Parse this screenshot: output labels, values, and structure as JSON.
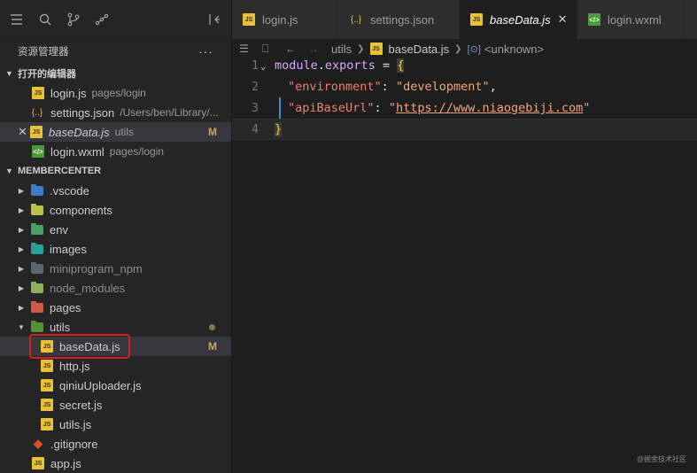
{
  "activity_bar": {
    "icons": [
      "files-icon",
      "search-icon",
      "source-control-icon",
      "graph-icon",
      "collapse-panel-icon"
    ]
  },
  "explorer": {
    "title": "资源管理器",
    "more": "···"
  },
  "open_editors": {
    "header": "打开的编辑器",
    "items": [
      {
        "name": "login.js",
        "desc": "pages/login",
        "type": "js"
      },
      {
        "name": "settings.json",
        "desc": "/Users/ben/Library/...",
        "type": "json"
      },
      {
        "name": "baseData.js",
        "desc": "utils",
        "type": "js",
        "badge": "M"
      },
      {
        "name": "login.wxml",
        "desc": "pages/login",
        "type": "wxml"
      }
    ]
  },
  "project": {
    "header": "MEMBERCENTER",
    "folders": [
      {
        "name": ".vscode"
      },
      {
        "name": "components"
      },
      {
        "name": "env"
      },
      {
        "name": "images"
      },
      {
        "name": "miniprogram_npm"
      },
      {
        "name": "node_modules"
      },
      {
        "name": "pages"
      },
      {
        "name": "utils"
      }
    ],
    "utils_files": [
      {
        "name": "baseData.js",
        "badge": "M"
      },
      {
        "name": "http.js"
      },
      {
        "name": "qiniuUploader.js"
      },
      {
        "name": "secret.js"
      },
      {
        "name": "utils.js"
      }
    ],
    "root_files": [
      {
        "name": ".gitignore"
      },
      {
        "name": "app.js"
      }
    ]
  },
  "tabs": [
    {
      "label": "login.js",
      "type": "js"
    },
    {
      "label": "settings.json",
      "type": "json"
    },
    {
      "label": "baseData.js",
      "type": "js"
    },
    {
      "label": "login.wxml",
      "type": "wxml"
    }
  ],
  "breadcrumb": {
    "folder": "utils",
    "file": "baseData.js",
    "symbol": "<unknown>"
  },
  "code": {
    "line_numbers": [
      "1",
      "2",
      "3",
      "4"
    ],
    "l1_kw": "module",
    "l1_dot": ".",
    "l1_prop": "exports",
    "l1_eq": " = ",
    "l1_brace": "{",
    "l2_key": "\"environment\"",
    "l2_colon": ": ",
    "l2_val": "\"development\"",
    "l2_comma": ",",
    "l3_key": "\"apiBaseUrl\"",
    "l3_colon": ": ",
    "l3_q1": "\"",
    "l3_url": "https://www.niaogebiji.com",
    "l3_q2": "\"",
    "l4_brace": "}"
  },
  "watermark": "@掘金技术社区",
  "colors": {
    "accent_highlight": "#d81f1f",
    "modified_badge": "#c7a86b"
  }
}
